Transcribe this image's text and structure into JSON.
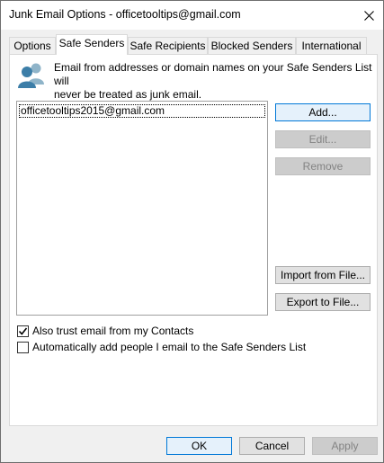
{
  "window": {
    "title": "Junk Email Options - officetooltips@gmail.com",
    "close_glyph": "✕"
  },
  "tabs": [
    {
      "label": "Options",
      "active": false
    },
    {
      "label": "Safe Senders",
      "active": true
    },
    {
      "label": "Safe Recipients",
      "active": false
    },
    {
      "label": "Blocked Senders",
      "active": false
    },
    {
      "label": "International",
      "active": false
    }
  ],
  "panel": {
    "icon": "people-icon",
    "info_line1": "Email from addresses or domain names on your Safe Senders List will",
    "info_line2": "never be treated as junk email.",
    "list_items": [
      "officetooltips2015@gmail.com"
    ],
    "buttons": {
      "add": "Add...",
      "edit": "Edit...",
      "remove": "Remove",
      "import": "Import from File...",
      "export": "Export to File..."
    },
    "checkboxes": [
      {
        "label": "Also trust email from my Contacts",
        "checked": true
      },
      {
        "label": "Automatically add people I email to the Safe Senders List",
        "checked": false
      }
    ]
  },
  "footer": {
    "ok": "OK",
    "cancel": "Cancel",
    "apply": "Apply"
  },
  "colors": {
    "accent": "#0078d7",
    "icon_primary": "#3c7ea8",
    "icon_secondary": "#8fb4c9"
  }
}
